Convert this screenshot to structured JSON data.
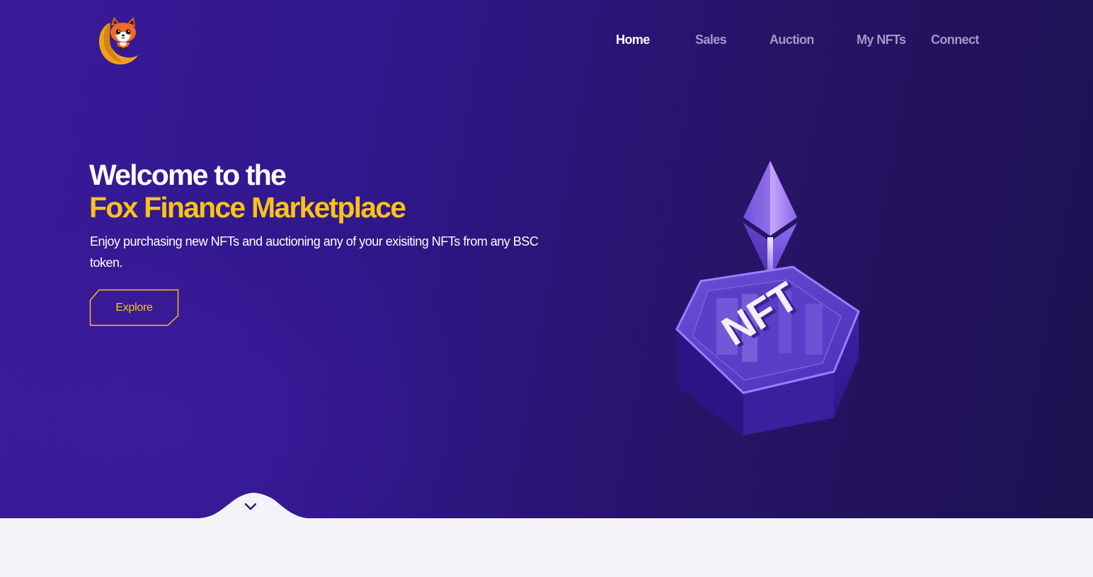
{
  "nav": {
    "items": [
      {
        "label": "Home",
        "active": true
      },
      {
        "label": "Sales",
        "active": false
      },
      {
        "label": "Auction",
        "active": false
      },
      {
        "label": "My NFTs",
        "active": false
      },
      {
        "label": "Connect",
        "active": false
      }
    ]
  },
  "hero": {
    "title_line1": "Welcome to the",
    "title_line2": "Fox Finance Marketplace",
    "description": "Enjoy purchasing new NFTs and auctioning any of your exisiting NFTs from any BSC token.",
    "cta_label": "Explore",
    "art_label": "NFT"
  },
  "icons": {
    "logo": "fox-logo-icon",
    "art": "nft-ethereum-illustration",
    "scroll": "chevron-down-icon"
  },
  "colors": {
    "accent": "#f9c21b",
    "hero_bg": "#2f178a",
    "nav_inactive": "#a29ac9",
    "nav_active": "#ffffff",
    "page_bg": "#f3f2f7"
  }
}
